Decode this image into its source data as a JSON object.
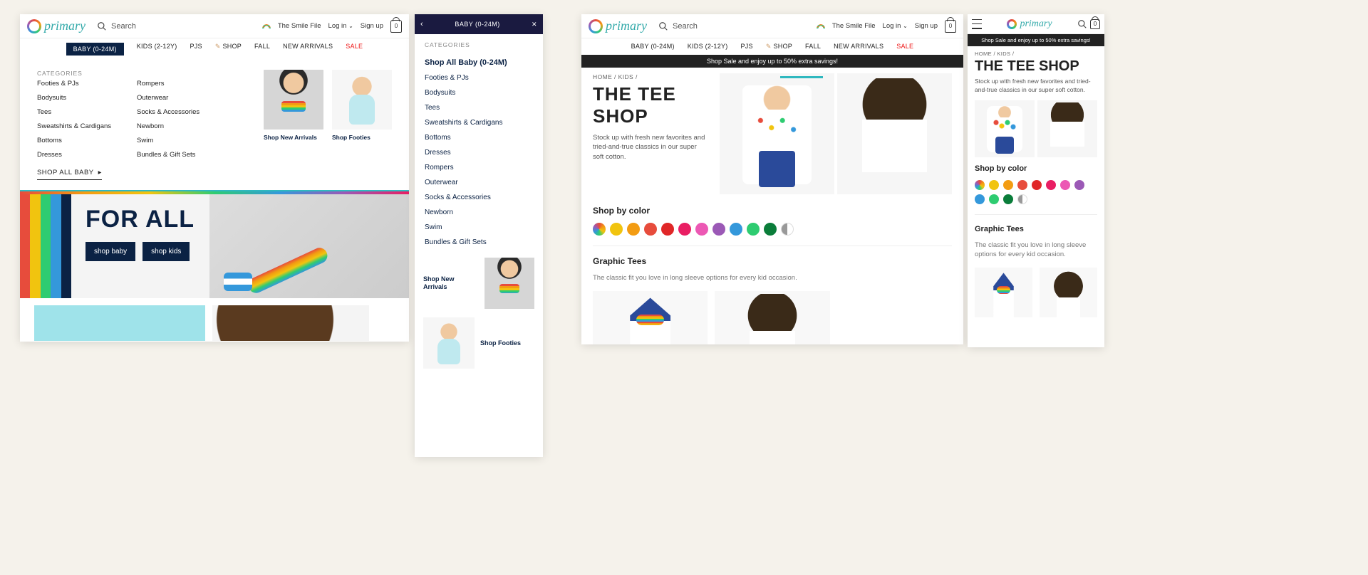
{
  "brand": "primary",
  "search_placeholder": "Search",
  "header_links": {
    "smile": "The Smile File",
    "login": "Log in",
    "signup": "Sign up",
    "bag_count": "0"
  },
  "nav": {
    "baby": "BABY (0-24M)",
    "kids": "KIDS (2-12Y)",
    "pjs": "PJS",
    "shop": "SHOP",
    "fall": "FALL",
    "new": "NEW ARRIVALS",
    "sale": "SALE"
  },
  "megamenu": {
    "heading": "CATEGORIES",
    "col1": [
      "Footies & PJs",
      "Bodysuits",
      "Tees",
      "Sweatshirts & Cardigans",
      "Bottoms",
      "Dresses"
    ],
    "col2": [
      "Rompers",
      "Outerwear",
      "Socks & Accessories",
      "Newborn",
      "Swim",
      "Bundles & Gift Sets"
    ],
    "shop_all": "SHOP ALL BABY",
    "card1": "Shop New Arrivals",
    "card2": "Shop Footies"
  },
  "hero": {
    "title": "FOR ALL",
    "btn1": "shop baby",
    "btn2": "shop kids"
  },
  "mobile_menu": {
    "title": "BABY (0-24M)",
    "heading": "CATEGORIES",
    "top_link": "Shop All Baby (0-24M)",
    "items": [
      "Footies & PJs",
      "Bodysuits",
      "Tees",
      "Sweatshirts & Cardigans",
      "Bottoms",
      "Dresses",
      "Rompers",
      "Outerwear",
      "Socks & Accessories",
      "Newborn",
      "Swim",
      "Bundles & Gift Sets"
    ],
    "feat1": "Shop New Arrivals",
    "feat2": "Shop Footies"
  },
  "promo": "Shop Sale and enjoy up to 50% extra savings!",
  "breadcrumb": {
    "home": "HOME",
    "kids": "KIDS",
    "sep": "/"
  },
  "tee": {
    "title": "THE TEE SHOP",
    "sub": "Stock up with fresh new favorites and tried-and-true classics in our super soft cotton."
  },
  "shop_by_color": "Shop by color",
  "color_swatches": [
    "rainbow",
    "#f1c40f",
    "#f39c12",
    "#e74c3c",
    "#e02728",
    "#e91e63",
    "#ec58b4",
    "#9b59b6",
    "#3498db",
    "#2ecc71",
    "#0a7d3a",
    "half"
  ],
  "graphic": {
    "title": "Graphic Tees",
    "sub": "The classic fit you love in long sleeve options for every kid occasion."
  }
}
